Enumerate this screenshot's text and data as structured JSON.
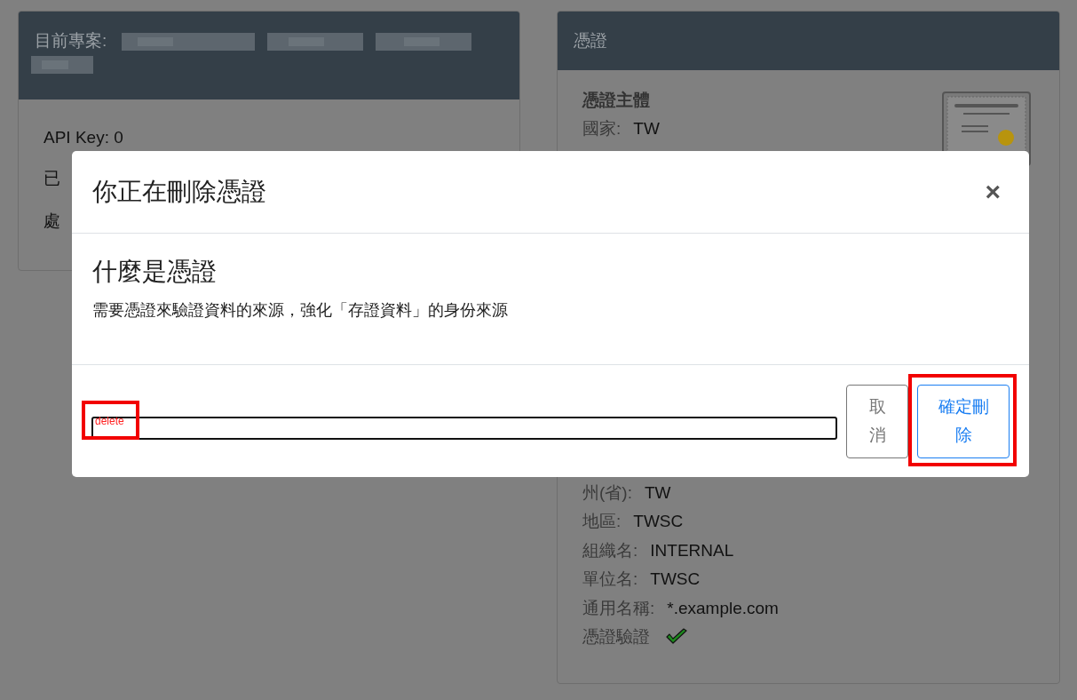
{
  "project_card": {
    "title": "目前專案:",
    "name_redacted": true,
    "lines": [
      "API Key: 0",
      "已",
      "處"
    ]
  },
  "certificate_card": {
    "title": "憑證",
    "subject_heading": "憑證主體",
    "subject_fields": [
      {
        "label": "國家:",
        "value": "TW"
      }
    ],
    "issuer_fields": [
      {
        "label": "州(省):",
        "value": "TW"
      },
      {
        "label": "地區:",
        "value": "TWSC"
      },
      {
        "label": "組織名:",
        "value": "INTERNAL"
      },
      {
        "label": "單位名:",
        "value": "TWSC"
      },
      {
        "label": "通用名稱:",
        "value": "*.example.com"
      }
    ],
    "verification": {
      "label": "憑證驗證",
      "verified": true
    }
  },
  "modal": {
    "title": "你正在刪除憑證",
    "close": "×",
    "heading": "什麼是憑證",
    "text": "需要憑證來驗證資料的來源，強化「存證資料」的身份來源",
    "buttons": [
      {
        "label": "取消",
        "kind": "secondary"
      },
      {
        "label": "確定刪除",
        "kind": "primary"
      }
    ]
  },
  "annotations": [
    {
      "kind": "box",
      "label": "delete"
    },
    {
      "kind": "box"
    }
  ]
}
